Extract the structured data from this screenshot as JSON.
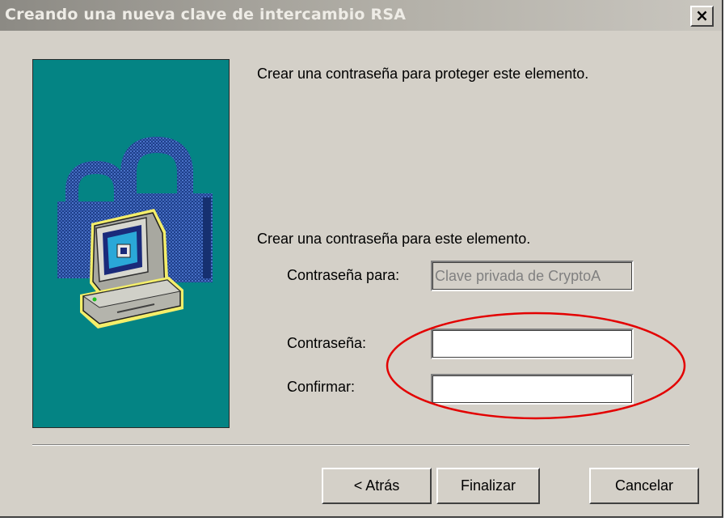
{
  "window": {
    "title": "Creando una nueva clave de intercambio RSA",
    "close_glyph": "×"
  },
  "wizard": {
    "illustration": "computer-with-padlocks-icon"
  },
  "content": {
    "intro_text": "Crear una contraseña para proteger este elemento.",
    "section_text": "Crear una contraseña para este elemento.",
    "password_for_label": "Contraseña para:",
    "password_for_value": "Clave privada de CryptoA",
    "password_label": "Contraseña:",
    "password_value": "",
    "confirm_label": "Confirmar:",
    "confirm_value": ""
  },
  "buttons": {
    "back_label": "< Atrás",
    "finish_label": "Finalizar",
    "cancel_label": "Cancelar"
  },
  "annotation": {
    "color": "#e30000"
  },
  "colors": {
    "dialog_face": "#d4d0c8",
    "wizard_panel": "#048484"
  }
}
